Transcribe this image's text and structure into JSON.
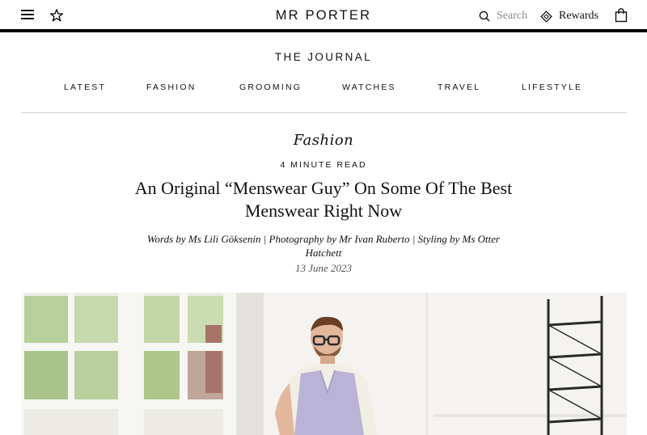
{
  "header": {
    "logo": "MR PORTER",
    "search_label": "Search",
    "rewards_label": "Rewards"
  },
  "journal": {
    "title": "THE JOURNAL",
    "nav": [
      "LATEST",
      "FASHION",
      "GROOMING",
      "WATCHES",
      "TRAVEL",
      "LIFESTYLE"
    ]
  },
  "article": {
    "category": "Fashion",
    "read_time": "4 MINUTE READ",
    "headline": "An Original “Menswear Guy” On Some Of The Best Menswear Right Now",
    "credits": "Words by Ms Lili Göksenin | Photography by Mr Ivan Ruberto | Styling by Ms Otter Hatchett",
    "date": "13 June 2023"
  },
  "icons": {
    "menu": "hamburger-menu-icon",
    "wishlist": "star-icon",
    "search": "magnifier-icon",
    "rewards": "diamond-tag-icon",
    "bag": "shopping-bag-icon"
  },
  "colors": {
    "text": "#111111",
    "muted": "#8a8a8a",
    "divider": "#cfcfcf"
  }
}
